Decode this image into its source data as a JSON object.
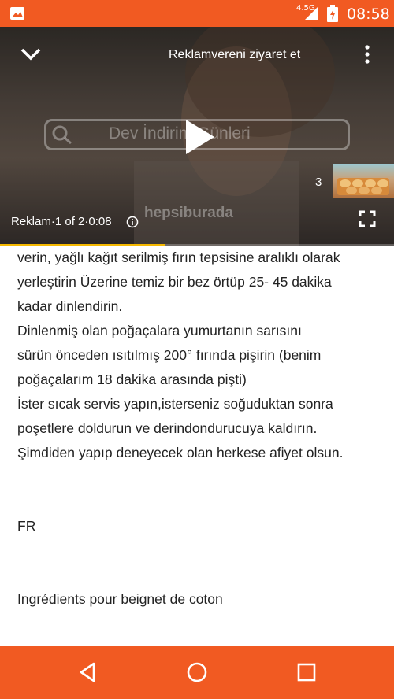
{
  "status_bar": {
    "network": "4.5G",
    "time": "08:58",
    "background_color": "#f15a22",
    "icons": [
      "gallery-icon",
      "signal-icon",
      "battery-icon"
    ]
  },
  "video_ad": {
    "visit_advertiser_label": "Reklamvereni ziyaret et",
    "ad_counter": "Reklam·1 of 2·0:08",
    "ad_search_text": "Dev İndirim Günleri",
    "brand_watermark": "hepsiburada",
    "queue_count": "3",
    "progress_fraction": 0.42,
    "progress_color": "#f5b800",
    "icons": [
      "collapse-chevron-icon",
      "more-vert-icon",
      "play-icon",
      "info-icon",
      "fullscreen-icon"
    ]
  },
  "article": {
    "lines": [
      "verin, yağlı kağıt serilmiş fırın tepsisine aralıklı olarak",
      "yerleştirin Üzerine temiz bir bez örtüp 25- 45 dakika",
      "kadar dinlendirin.",
      "Dinlenmiş olan poğaçalara yumurtanın sarısını",
      "sürün önceden ısıtılmış 200° fırında pişirin (benim",
      "poğaçalarım 18 dakika  arasında pişti)",
      "İster sıcak servis yapın,isterseniz soğuduktan sonra",
      "poşetlere doldurun ve derindondurucuya kaldırın.",
      "Şimdiden yapıp deneyecek olan herkese afiyet olsun.",
      "",
      "",
      "FR",
      "",
      "",
      "Ingrédients pour beignet de coton"
    ]
  },
  "nav_bar": {
    "background_color": "#f15a22",
    "icons": [
      "back-icon",
      "home-icon",
      "recents-icon"
    ]
  }
}
